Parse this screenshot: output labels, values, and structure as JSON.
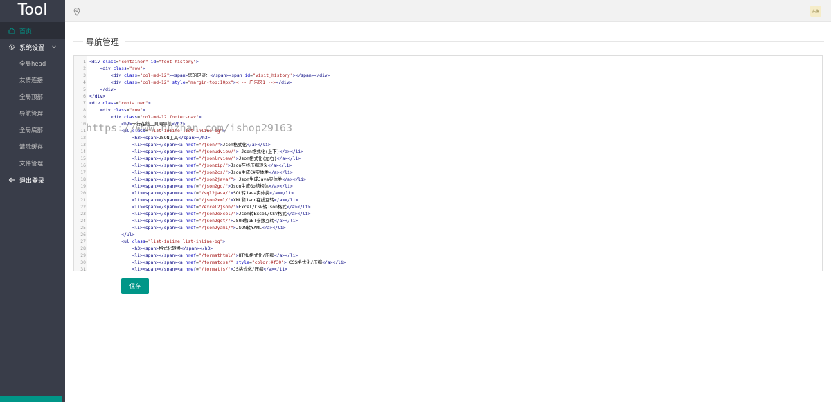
{
  "app": {
    "logo": "Tool"
  },
  "sidebar": {
    "items": [
      {
        "label": "首页",
        "icon": "home-icon",
        "active": true
      },
      {
        "label": "系统设置",
        "icon": "gear-icon",
        "expanded": true
      }
    ],
    "sub_items": [
      {
        "label": "全局head"
      },
      {
        "label": "友情连接"
      },
      {
        "label": "全局顶部"
      },
      {
        "label": "导航管理"
      },
      {
        "label": "全局底部"
      },
      {
        "label": "清除缓存"
      },
      {
        "label": "文件管理"
      }
    ],
    "logout": {
      "label": "退出登录",
      "icon": "arrow-left-icon"
    }
  },
  "topbar": {
    "location_icon": "location-pin-icon",
    "avatar_text": "头像"
  },
  "main": {
    "title": "导航管理",
    "save_label": "保存",
    "code_lines": [
      {
        "n": "1",
        "text": "<div class=\"container\" id=\"foot-history\">"
      },
      {
        "n": "2",
        "text": "    <div class=\"row\">"
      },
      {
        "n": "3",
        "text": "        <div class=\"col-md-12\"><span>您的足迹：</span><span id=\"visit_history\"></span></div>"
      },
      {
        "n": "4",
        "text": "        <div class=\"col-md-12\" style=\"margin-top:10px\"><!-- 广告区1 --></div>"
      },
      {
        "n": "5",
        "text": "    </div>"
      },
      {
        "n": "6",
        "text": "</div>"
      },
      {
        "n": "7",
        "text": "<div class=\"container\">"
      },
      {
        "n": "8",
        "text": "    <div class=\"row\">"
      },
      {
        "n": "9",
        "text": "        <div class=\"col-md-12 footer-nav\">"
      },
      {
        "n": "10",
        "text": "            <h2>一行在线工具网导航</h2>"
      },
      {
        "n": "11",
        "text": "            <ul class=\"list-inline list-inline-bg\">"
      },
      {
        "n": "12",
        "text": "                <h3><span>JSON工具</span></h3>"
      },
      {
        "n": "13",
        "text": "                <li><span></span><a href=\"/json/\">Json格式化</a></li>"
      },
      {
        "n": "14",
        "text": "                <li><span></span><a href=\"/jsonudview/\"> Json格式化(上下)</a></li>"
      },
      {
        "n": "15",
        "text": "                <li><span></span><a href=\"/jsonlrview/\">Json格式化(左右)</a></li>"
      },
      {
        "n": "16",
        "text": "                <li><span></span><a href=\"/jsonzip/\">Json在线压缩转义</a></li>"
      },
      {
        "n": "17",
        "text": "                <li><span></span><a href=\"/json2cs/\">Json生成C#实体类</a></li>"
      },
      {
        "n": "18",
        "text": "                <li><span></span><a href=\"/json2java/\"> Json生成Java实体类</a></li>"
      },
      {
        "n": "19",
        "text": "                <li><span></span><a href=\"/json2go/\">Json生成Go结构体</a></li>"
      },
      {
        "n": "20",
        "text": "                <li><span></span><a href=\"/sql2java/\">SQL转Java实体类</a></li>"
      },
      {
        "n": "21",
        "text": "                <li><span></span><a href=\"/json2xml/\">XML和Json在线互转</a></li>"
      },
      {
        "n": "22",
        "text": "                <li><span></span><a href=\"/excel2json/\">Excel/CSV转Json格式</a></li>"
      },
      {
        "n": "23",
        "text": "                <li><span></span><a href=\"/json2excel/\">Json转Excel/CSV格式</a></li>"
      },
      {
        "n": "24",
        "text": "                <li><span></span><a href=\"/json2get/\">JSON和GET参数互转</a></li>"
      },
      {
        "n": "25",
        "text": "                <li><span></span><a href=\"/json2yaml/\">JSON转YAML</a></li>"
      },
      {
        "n": "26",
        "text": "            </ul>"
      },
      {
        "n": "27",
        "text": "            <ul class=\"list-inline list-inline-bg\">"
      },
      {
        "n": "28",
        "text": "                <h3><span>格式化转换</span></h3>"
      },
      {
        "n": "29",
        "text": "                <li><span></span><a href=\"/formathtml/\">HTML格式化/压缩</a></li>"
      },
      {
        "n": "30",
        "text": "                <li><span></span><a href=\"/formatcss/\" style=\"color:#f30\"> CSS格式化/压缩</a></li>"
      },
      {
        "n": "31",
        "text": "                <li><span></span><a href=\"/formatjs/\">JS格式化/压缩</a></li>"
      }
    ]
  },
  "watermark": "https://www.huzhan.com/ishop29163",
  "colors": {
    "sidebar_bg": "#393d49",
    "accent": "#009688",
    "tag": "#000080",
    "attr": "#0000c0",
    "string": "#a31515"
  }
}
